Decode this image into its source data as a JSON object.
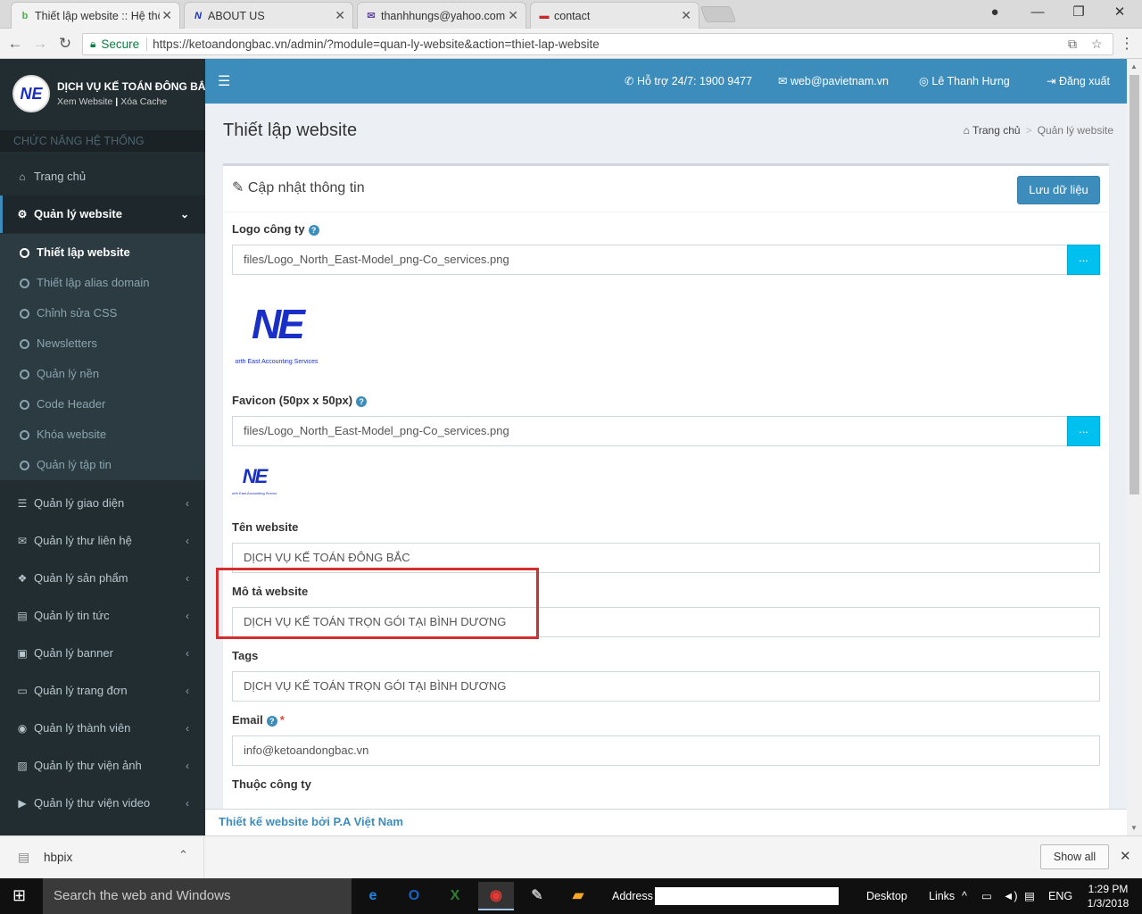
{
  "browser": {
    "tabs": [
      {
        "label": "Thiết lập website :: Hệ thống",
        "favicon": "b"
      },
      {
        "label": "ABOUT US",
        "favicon": "NE"
      },
      {
        "label": "thanhhungs@yahoo.com",
        "favicon": "mail"
      },
      {
        "label": "contact",
        "favicon": "img"
      }
    ],
    "secure_label": "Secure",
    "url": "https://ketoandongbac.vn/admin/?module=quan-ly-website&action=thiet-lap-website"
  },
  "brand": {
    "name": "DỊCH VỤ KẾ TOÁN ĐÔNG BẮC",
    "view_site": "Xem Website",
    "clear_cache": "Xóa Cache",
    "logo_text": "NE"
  },
  "sidebar": {
    "section": "CHỨC NĂNG HỆ THỐNG",
    "home": "Trang chủ",
    "website_mgmt": "Quản lý website",
    "sub_items": [
      "Thiết lập website",
      "Thiết lập alias domain",
      "Chỉnh sửa CSS",
      "Newsletters",
      "Quản lý nền",
      "Code Header",
      "Khóa website",
      "Quản lý tập tin"
    ],
    "items": [
      "Quản lý giao diện",
      "Quản lý thư liên hệ",
      "Quản lý sản phẩm",
      "Quản lý tin tức",
      "Quản lý banner",
      "Quản lý trang đơn",
      "Quản lý thành viên",
      "Quản lý thư viện ảnh",
      "Quản lý thư viện video"
    ]
  },
  "topbar": {
    "support": "Hỗ trợ 24/7: 1900 9477",
    "email": "web@pavietnam.vn",
    "user": "Lê Thanh Hưng",
    "logout": "Đăng xuất"
  },
  "page": {
    "title": "Thiết lập website",
    "breadcrumb_home": "Trang chủ",
    "breadcrumb_current": "Quản lý website"
  },
  "form": {
    "box_title": "Cập nhật thông tin",
    "save_label": "Lưu dữ liệu",
    "logo_label": "Logo công ty",
    "logo_value": "files/Logo_North_East-Model_png-Co_services.png",
    "logo_caption": "orth East Accounting Services",
    "favicon_label": "Favicon (50px x 50px)",
    "favicon_value": "files/Logo_North_East-Model_png-Co_services.png",
    "browse_label": "...",
    "name_label": "Tên website",
    "name_value": "DỊCH VỤ KẾ TOÁN ĐÔNG BẮC",
    "desc_label": "Mô tả website",
    "desc_value": "DỊCH VỤ KẾ TOÁN TRỌN GÓI TẠI BÌNH DƯƠNG",
    "tags_label": "Tags",
    "tags_value": "DỊCH VỤ KẾ TOÁN TRỌN GÓI TẠI BÌNH DƯƠNG",
    "email_label": "Email",
    "email_required": "*",
    "email_value": "info@ketoandongbac.vn",
    "company_label": "Thuộc công ty"
  },
  "footer": {
    "text": "Thiết kế website bởi P.A Việt Nam"
  },
  "download_bar": {
    "file": "hbpix",
    "show_all": "Show all"
  },
  "taskbar": {
    "search": "Search the web and Windows",
    "address": "Address",
    "desktop": "Desktop",
    "links": "Links",
    "lang": "ENG",
    "time": "1:29 PM",
    "date": "1/3/2018"
  },
  "colors": {
    "primary": "#3c8dbc",
    "sidebar": "#222d32",
    "highlight": "#d32f2f",
    "browse": "#00c0ef"
  }
}
